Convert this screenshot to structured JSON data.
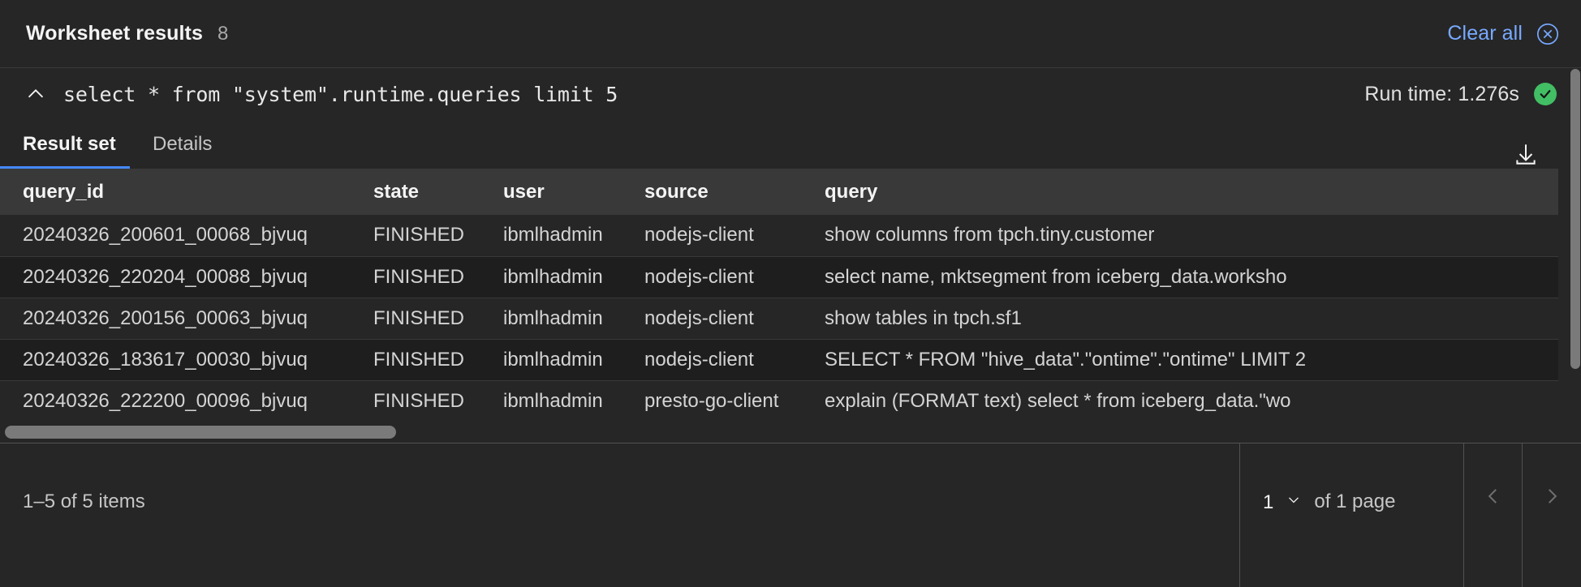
{
  "header": {
    "title": "Worksheet results",
    "count": "8",
    "clear_all_label": "Clear all",
    "clear_all_icon": "close-circle-icon"
  },
  "query_bar": {
    "collapse_icon": "chevron-up-icon",
    "query_text": "select * from \"system\".runtime.queries limit 5",
    "run_time_label": "Run time: 1.276s",
    "status_icon": "checkmark-filled-icon",
    "status_color": "#42be65"
  },
  "tabs": {
    "items": [
      {
        "label": "Result set",
        "active": true
      },
      {
        "label": "Details",
        "active": false
      }
    ],
    "download_icon": "download-icon"
  },
  "table": {
    "columns": [
      "query_id",
      "state",
      "user",
      "source",
      "query"
    ],
    "rows": [
      {
        "query_id": "20240326_200601_00068_bjvuq",
        "state": "FINISHED",
        "user": "ibmlhadmin",
        "source": "nodejs-client",
        "query": "show columns from tpch.tiny.customer"
      },
      {
        "query_id": "20240326_220204_00088_bjvuq",
        "state": "FINISHED",
        "user": "ibmlhadmin",
        "source": "nodejs-client",
        "query": "select name, mktsegment from iceberg_data.worksho"
      },
      {
        "query_id": "20240326_200156_00063_bjvuq",
        "state": "FINISHED",
        "user": "ibmlhadmin",
        "source": "nodejs-client",
        "query": "show tables in tpch.sf1"
      },
      {
        "query_id": "20240326_183617_00030_bjvuq",
        "state": "FINISHED",
        "user": "ibmlhadmin",
        "source": "nodejs-client",
        "query": "SELECT * FROM \"hive_data\".\"ontime\".\"ontime\" LIMIT 2"
      },
      {
        "query_id": "20240326_222200_00096_bjvuq",
        "state": "FINISHED",
        "user": "ibmlhadmin",
        "source": "presto-go-client",
        "query": "explain (FORMAT text) select * from iceberg_data.\"wo"
      }
    ]
  },
  "pagination": {
    "items_range": "1–5 of 5 items",
    "page_value": "1",
    "page_of": "of 1 page",
    "prev_icon": "caret-left-icon",
    "next_icon": "caret-right-icon",
    "chevron_icon": "chevron-down-icon"
  },
  "colors": {
    "accent_blue": "#4589ff",
    "link_blue": "#78a9ff",
    "success_green": "#42be65",
    "panel_bg": "#262626",
    "header_row_bg": "#393939"
  }
}
